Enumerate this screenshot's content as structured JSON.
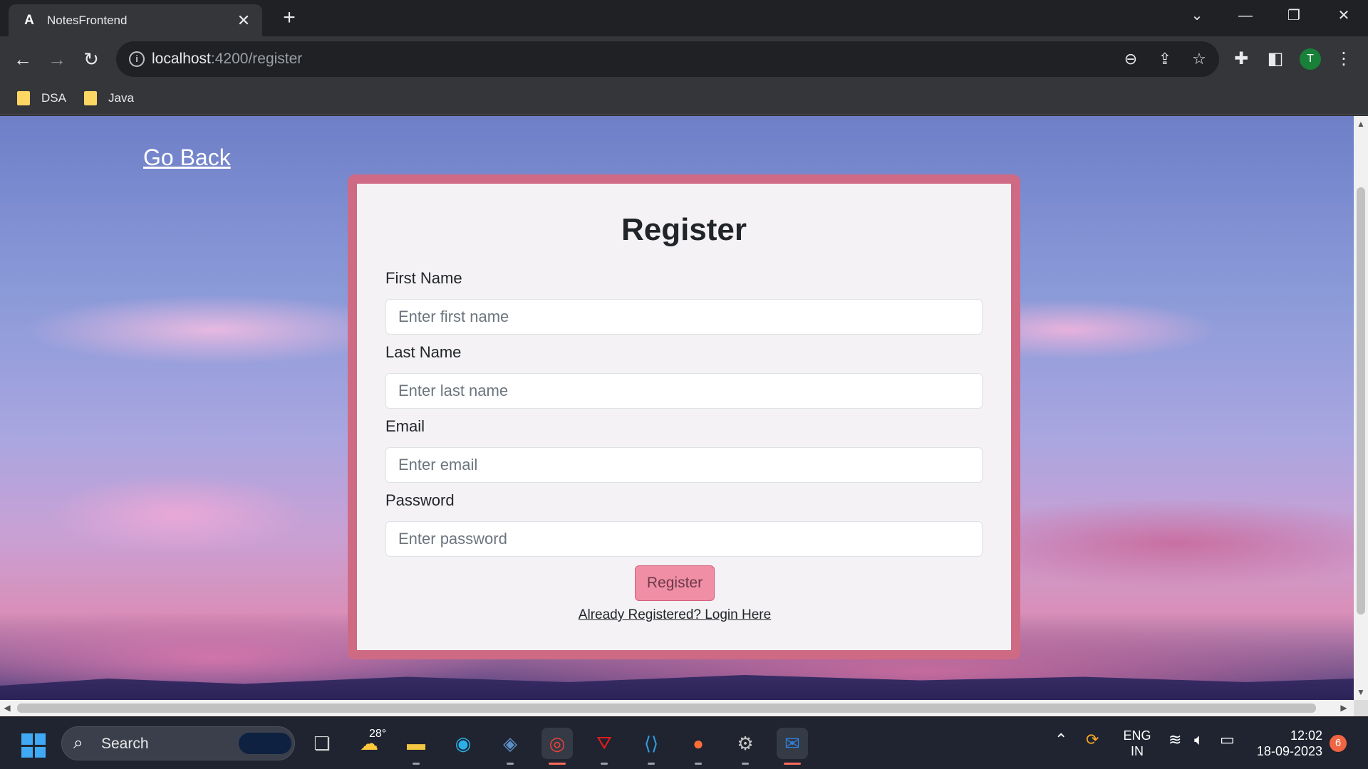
{
  "browser": {
    "tab_title": "NotesFrontend",
    "tab_favicon": "A",
    "close_glyph": "✕",
    "new_tab_glyph": "+",
    "url_host": "localhost",
    "url_rest": ":4200/register",
    "profile_initial": "T",
    "bookmarks": [
      {
        "label": "DSA",
        "icon": "folder-icon"
      },
      {
        "label": "Java",
        "icon": "folder-icon"
      }
    ]
  },
  "page": {
    "go_back": "Go Back",
    "title": "Register",
    "fields": [
      {
        "label": "First Name",
        "placeholder": "Enter first name",
        "type": "text"
      },
      {
        "label": "Last Name",
        "placeholder": "Enter last name",
        "type": "text"
      },
      {
        "label": "Email",
        "placeholder": "Enter email",
        "type": "email"
      },
      {
        "label": "Password",
        "placeholder": "Enter password",
        "type": "password"
      }
    ],
    "submit_label": "Register",
    "login_link": "Already Registered? Login Here"
  },
  "taskbar": {
    "search_label": "Search",
    "search_badge": "",
    "weather_temp": "28°",
    "language_line1": "ENG",
    "language_line2": "IN",
    "time": "12:02",
    "date": "18-09-2023",
    "notification_count": "6"
  },
  "colors": {
    "card_border": "#cf6a84",
    "button_bg": "#f08ea6",
    "chrome_dark": "#202124",
    "chrome_mid": "#35363a"
  }
}
